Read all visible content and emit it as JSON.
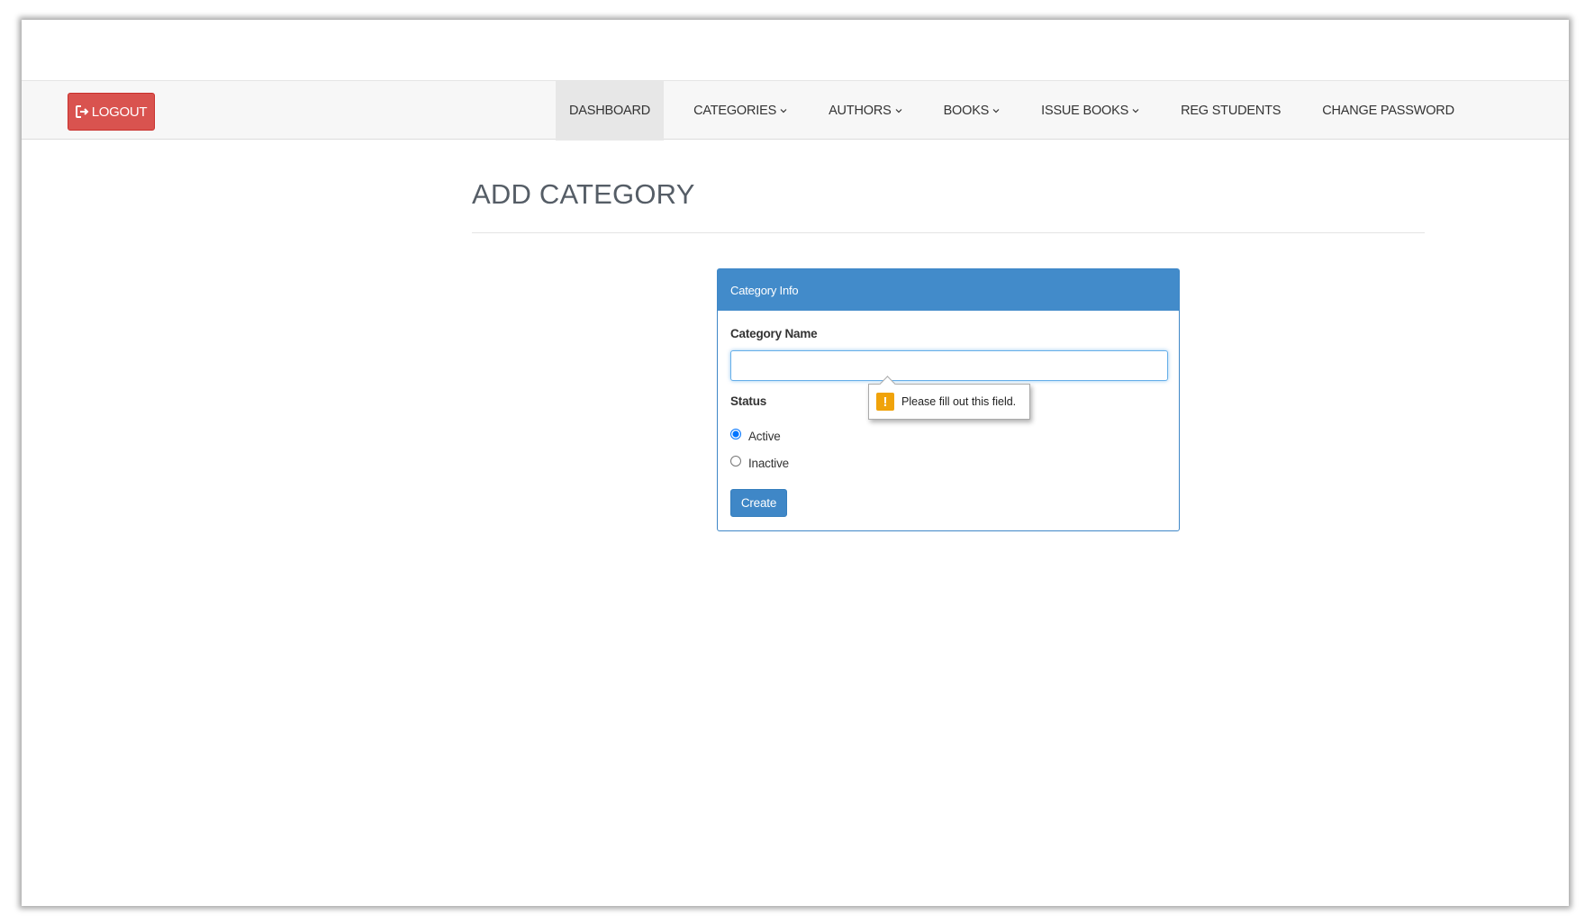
{
  "header": {
    "logout_label": "LOGOUT"
  },
  "nav": {
    "items": [
      {
        "label": "DASHBOARD",
        "dropdown": false,
        "active": true
      },
      {
        "label": "CATEGORIES",
        "dropdown": true
      },
      {
        "label": "AUTHORS",
        "dropdown": true
      },
      {
        "label": "BOOKS",
        "dropdown": true
      },
      {
        "label": "ISSUE BOOKS",
        "dropdown": true
      },
      {
        "label": "REG STUDENTS",
        "dropdown": false
      },
      {
        "label": "CHANGE PASSWORD",
        "dropdown": false
      }
    ]
  },
  "page": {
    "title": "ADD CATEGORY"
  },
  "form": {
    "panel_title": "Category Info",
    "category_name_label": "Category Name",
    "category_name_value": "",
    "status_label": "Status",
    "status_options": [
      {
        "label": "Active",
        "checked": true
      },
      {
        "label": "Inactive",
        "checked": false
      }
    ],
    "submit_label": "Create"
  },
  "validation": {
    "message": "Please fill out this field.",
    "icon": "warning-icon"
  },
  "colors": {
    "logout": "#d9534f",
    "primary": "#428bca",
    "warning": "#f0a30a"
  }
}
